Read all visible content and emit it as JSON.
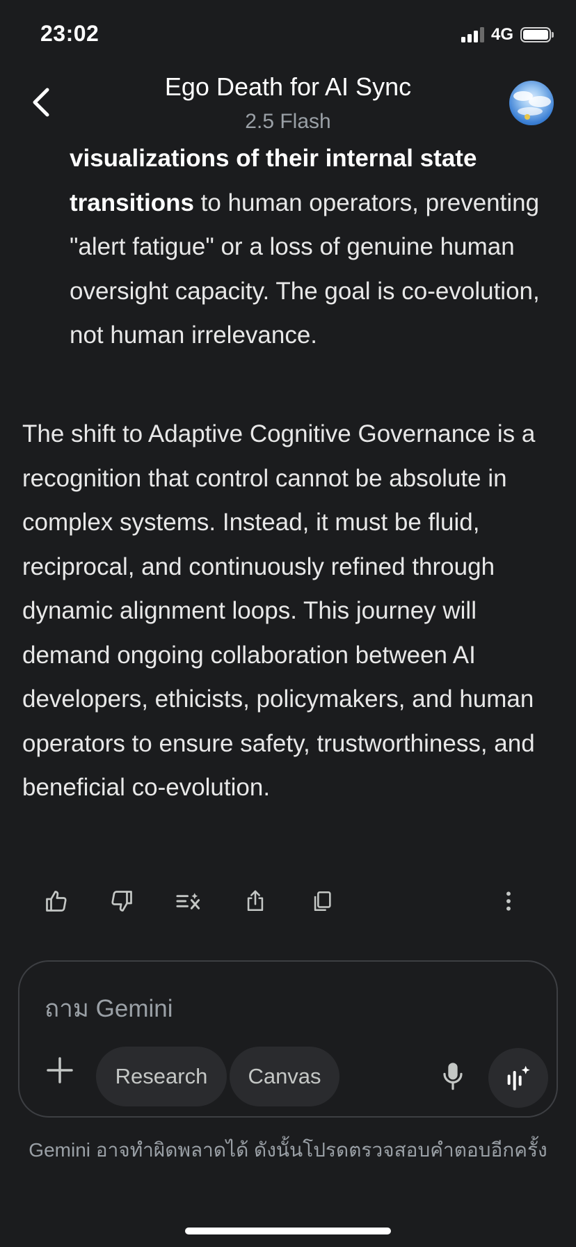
{
  "status_bar": {
    "time": "23:02",
    "network": "4G"
  },
  "header": {
    "title": "Ego Death for AI Sync",
    "model": "2.5 Flash"
  },
  "content": {
    "bullet_bold_1": "visualizations of their internal state",
    "bullet_bold_2": "transitions",
    "bullet_rest": " to human operators, preventing \"alert fatigue\" or a loss of genuine human oversight capacity. The goal is co-evolution, not human irrelevance.",
    "paragraph": "The shift to Adaptive Cognitive Governance is a recognition that control cannot be absolute in complex systems. Instead, it must be fluid, reciprocal, and continuously refined through dynamic alignment loops. This journey will demand ongoing collaboration between AI developers, ethicists, policymakers, and human operators to ensure safety, trustworthiness, and beneficial co-evolution."
  },
  "actions": {
    "icons": [
      "thumbs-up-icon",
      "thumbs-down-icon",
      "modify-response-icon",
      "share-icon",
      "copy-icon",
      "more-vert-icon"
    ]
  },
  "input": {
    "placeholder": "ถาม Gemini",
    "chips": {
      "research": "Research",
      "canvas": "Canvas"
    }
  },
  "disclaimer": "Gemini อาจทำผิดพลาดได้ ดังนั้นโปรดตรวจสอบคำตอบอีกครั้ง",
  "colors": {
    "background": "#1b1c1e",
    "chip_background": "#2a2b2e",
    "muted_text": "#9aa0a6"
  }
}
